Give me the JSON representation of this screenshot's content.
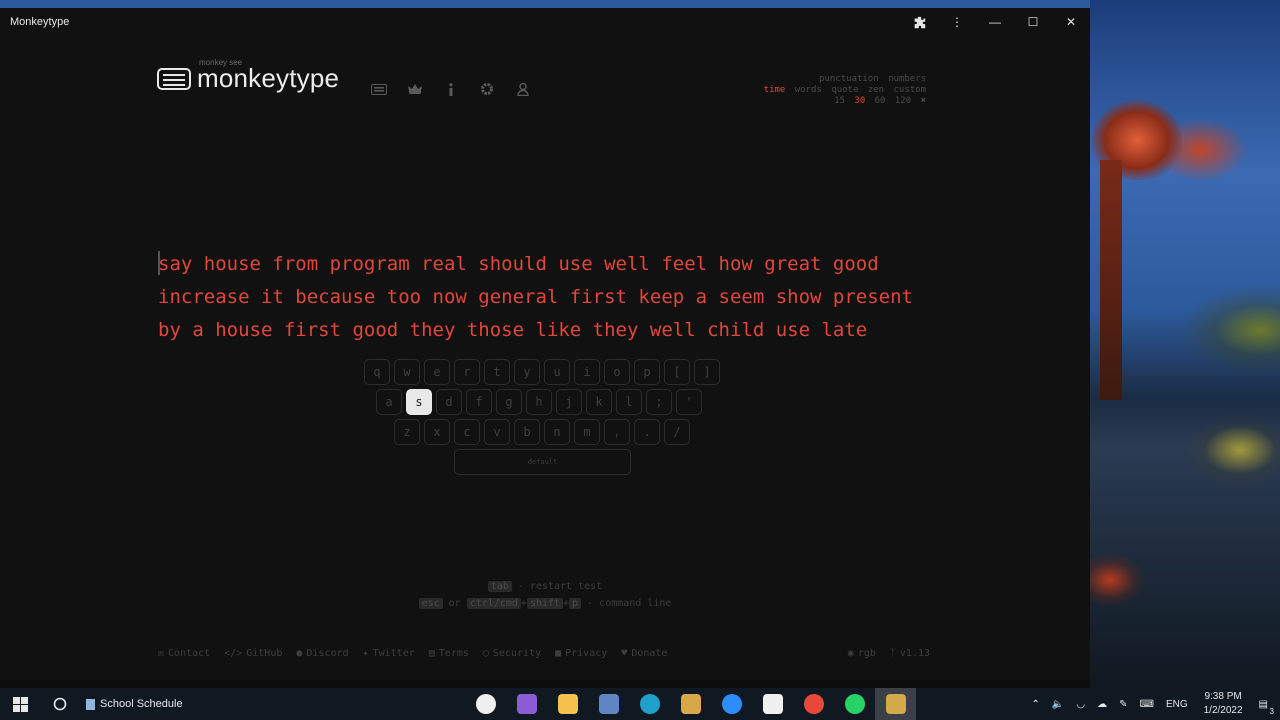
{
  "window": {
    "title": "Monkeytype"
  },
  "header": {
    "logo_sub": "monkey see",
    "logo_main": "monkeytype",
    "nav_icons": [
      "keyboard-icon",
      "crown-icon",
      "info-icon",
      "settings-icon",
      "user-icon"
    ]
  },
  "config": {
    "row1": [
      "punctuation",
      "numbers"
    ],
    "row2": [
      "time",
      "words",
      "quote",
      "zen",
      "custom"
    ],
    "row2_active": "time",
    "row3": [
      "15",
      "30",
      "60",
      "120"
    ],
    "row3_active": "30"
  },
  "test": {
    "line1": "say house from program real should use well feel how great good",
    "line2": "increase it because too now general first keep a seem show present",
    "line3": "by a house first good they those like they well child use late",
    "text_color": "#e2463a"
  },
  "keyboard": {
    "row1": [
      "q",
      "w",
      "e",
      "r",
      "t",
      "y",
      "u",
      "i",
      "o",
      "p",
      "[",
      "]"
    ],
    "row2": [
      "a",
      "s",
      "d",
      "f",
      "g",
      "h",
      "j",
      "k",
      "l",
      ";",
      "'"
    ],
    "row3": [
      "z",
      "x",
      "c",
      "v",
      "b",
      "n",
      "m",
      ",",
      ".",
      "/"
    ],
    "active_key": "s",
    "space_label": "default"
  },
  "hints": {
    "restart_key": "tab",
    "restart_text": "- restart test",
    "esc_key": "esc",
    "or_text": "or",
    "ctrl_key": "ctrl/cmd",
    "shift_key": "shift",
    "p_key": "p",
    "command_text": "- command line"
  },
  "footer": {
    "links": [
      {
        "icon": "envelope-icon",
        "label": "Contact"
      },
      {
        "icon": "code-icon",
        "label": "GitHub"
      },
      {
        "icon": "discord-icon",
        "label": "Discord"
      },
      {
        "icon": "twitter-icon",
        "label": "Twitter"
      },
      {
        "icon": "document-icon",
        "label": "Terms"
      },
      {
        "icon": "shield-icon",
        "label": "Security"
      },
      {
        "icon": "lock-icon",
        "label": "Privacy"
      },
      {
        "icon": "donate-icon",
        "label": "Donate"
      }
    ],
    "theme": "rgb",
    "version": "v1.13"
  },
  "taskbar": {
    "active_window": "School Schedule",
    "pinned_apps": [
      {
        "name": "clock-app-icon",
        "color": "#f0f0f0"
      },
      {
        "name": "visual-studio-icon",
        "color": "#8a5cd6"
      },
      {
        "name": "file-explorer-icon",
        "color": "#f2c14e"
      },
      {
        "name": "calculator-icon",
        "color": "#5e86c4"
      },
      {
        "name": "edge-icon",
        "color": "#1fa0c9"
      },
      {
        "name": "word-icon",
        "color": "#d9a64a"
      },
      {
        "name": "zoom-icon",
        "color": "#2d8cff"
      },
      {
        "name": "acrobat-icon",
        "color": "#f0f0f0"
      },
      {
        "name": "chrome-icon",
        "color": "#e8493a"
      },
      {
        "name": "whatsapp-icon",
        "color": "#25d366"
      },
      {
        "name": "monkeytype-app-icon",
        "color": "#d1a94a"
      }
    ],
    "language": "ENG",
    "time": "9:38 PM",
    "date": "1/2/2022",
    "notifications": "3"
  }
}
